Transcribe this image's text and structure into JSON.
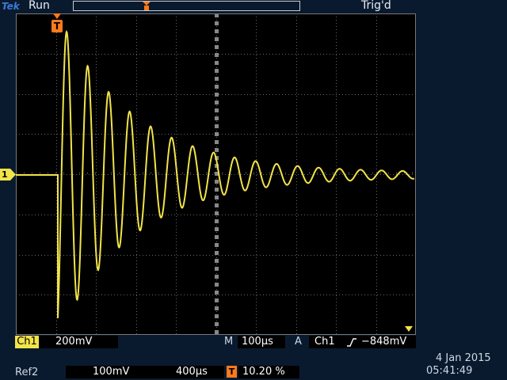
{
  "header": {
    "logo": "Tek",
    "run_status": "Run",
    "trig_status": "Trig'd"
  },
  "screen": {
    "trigger_marker": "T",
    "channel_marker": "1"
  },
  "readouts": {
    "ch1_label": "Ch1",
    "ch1_scale": "200mV",
    "m_label": "M",
    "timebase": "100µs",
    "a_label": "A",
    "trig_source": "Ch1",
    "trig_level": "−848mV",
    "ref_label": "Ref2",
    "ref_scale": "100mV",
    "ref_time": "400µs",
    "trigger_position_icon": "T",
    "trigger_position": "10.20 %",
    "date": "4 Jan  2015",
    "time": "05:41:49"
  },
  "colors": {
    "trace": "#f1e34a",
    "trigger": "#ff7a1a",
    "background": "#0a1a2e",
    "screen": "#000000"
  },
  "icons": {
    "trigger_slope": "rising-edge-icon",
    "trigger_position": "trigger-t-icon"
  }
}
